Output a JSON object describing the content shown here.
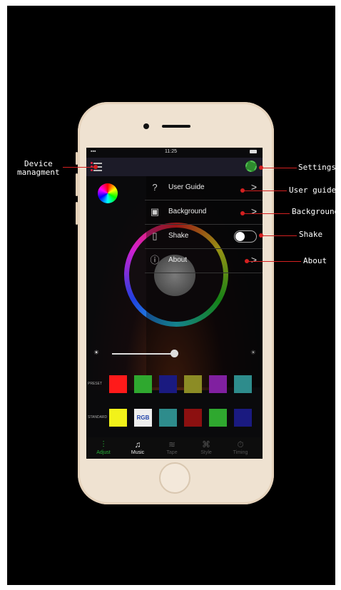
{
  "status": {
    "time": "11:25"
  },
  "settings_menu": [
    {
      "label": "User Guide",
      "icon": "question-icon"
    },
    {
      "label": "Background",
      "icon": "image-icon"
    },
    {
      "label": "Shake",
      "icon": "shake-icon",
      "toggle": false
    },
    {
      "label": "About",
      "icon": "info-icon"
    }
  ],
  "swatches": {
    "preset_label": "PRESET",
    "preset": [
      "#ff1a1a",
      "#2fa82f",
      "#1a1a80",
      "#8c8c25",
      "#8020a0",
      "#2e8c8c"
    ],
    "standard_label": "STANDARD",
    "standard": [
      "#f2f21a",
      "RGB",
      "#2e8c8c",
      "#8c1010",
      "#2fa82f",
      "#1a1a80"
    ],
    "rgb_text": "RGB"
  },
  "tabs": [
    {
      "label": "Adjust",
      "icon": "sliders-icon"
    },
    {
      "label": "Music",
      "icon": "music-icon"
    },
    {
      "label": "Tape",
      "icon": "tape-icon"
    },
    {
      "label": "Style",
      "icon": "style-icon"
    },
    {
      "label": "Timing",
      "icon": "timer-icon"
    }
  ],
  "callouts": {
    "device_line1": "Device",
    "device_line2": "managment",
    "settings": "Settings",
    "user_guide": "User guide",
    "background": "Background",
    "shake": "Shake",
    "about": "About"
  },
  "colors": {
    "accent": "#27b337",
    "callout_line": "#d42020"
  }
}
